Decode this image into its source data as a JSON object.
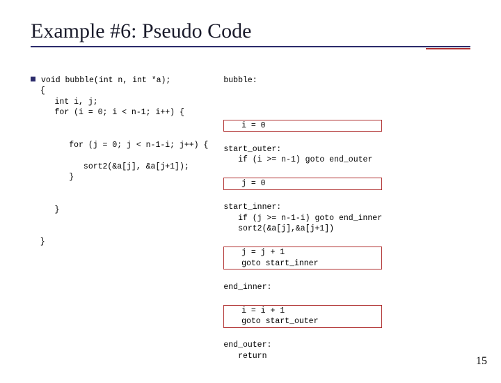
{
  "title": "Example #6: Pseudo Code",
  "page_number": "15",
  "code_left": {
    "l1": "void bubble(int n, int *a);",
    "l2": "{",
    "l3": "   int i, j;",
    "l4": "   for (i = 0; i < n-1; i++) {",
    "l5": "",
    "l6": "",
    "l7": "      for (j = 0; j < n-1-i; j++) {",
    "l8": "",
    "l9": "         sort2(&a[j], &a[j+1]);",
    "l10": "      }",
    "l11": "",
    "l12": "",
    "l13": "   }",
    "l14": "",
    "l15": "",
    "l16": "}"
  },
  "code_right": {
    "header": "bubble:",
    "box1_l1": "   i = 0",
    "mid1_l1": "start_outer:",
    "mid1_l2": "   if (i >= n-1) goto end_outer",
    "box2_l1": "   j = 0",
    "mid2_l1": "start_inner:",
    "mid2_l2": "   if (j >= n-1-i) goto end_inner",
    "mid2_l3": "   sort2(&a[j],&a[j+1])",
    "box3_l1": "   j = j + 1",
    "box3_l2": "   goto start_inner",
    "mid3_l1": "end_inner:",
    "box4_l1": "   i = i + 1",
    "box4_l2": "   goto start_outer",
    "tail_l1": "end_outer:",
    "tail_l2": "   return"
  }
}
